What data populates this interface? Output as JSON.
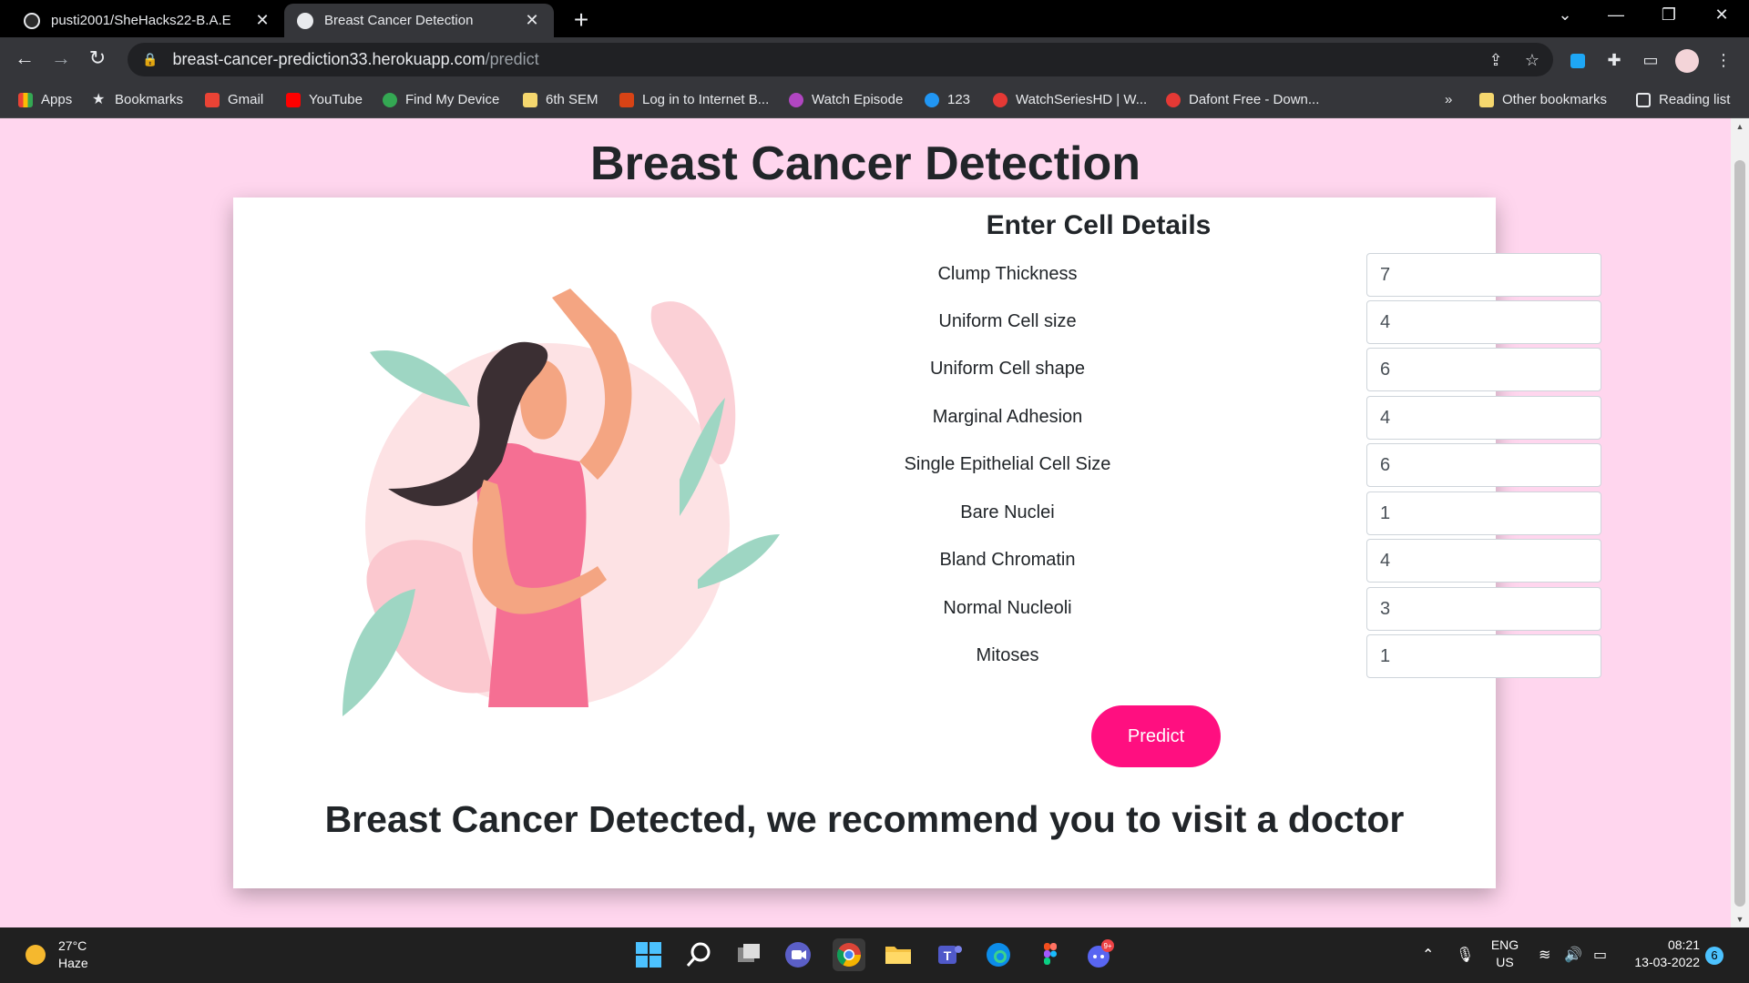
{
  "browser": {
    "tabs": [
      {
        "title": "pusti2001/SheHacks22-B.A.E",
        "active": false
      },
      {
        "title": "Breast Cancer Detection",
        "active": true
      }
    ],
    "url": {
      "host": "breast-cancer-prediction33.herokuapp.com",
      "path": "/predict"
    },
    "bookmarks": [
      "Apps",
      "Bookmarks",
      "Gmail",
      "YouTube",
      "Find My Device",
      "6th SEM",
      "Log in to Internet B...",
      "Watch Episode",
      "123",
      "WatchSeriesHD | W...",
      "Dafont Free - Down..."
    ],
    "other_bookmarks": "Other bookmarks",
    "reading_list": "Reading list",
    "overflow": "»"
  },
  "page": {
    "title": "Breast Cancer Detection",
    "form_title": "Enter Cell Details",
    "fields": [
      {
        "label": "Clump Thickness",
        "value": "7"
      },
      {
        "label": "Uniform Cell size",
        "value": "4"
      },
      {
        "label": "Uniform Cell shape",
        "value": "6"
      },
      {
        "label": "Marginal Adhesion",
        "value": "4"
      },
      {
        "label": "Single Epithelial Cell Size",
        "value": "6"
      },
      {
        "label": "Bare Nuclei",
        "value": "1"
      },
      {
        "label": "Bland Chromatin",
        "value": "4"
      },
      {
        "label": "Normal Nucleoli",
        "value": "3"
      },
      {
        "label": "Mitoses",
        "value": "1"
      }
    ],
    "predict_label": "Predict",
    "result": "Breast Cancer Detected, we recommend you to visit a doctor"
  },
  "taskbar": {
    "weather_temp": "27°C",
    "weather_desc": "Haze",
    "lang_line1": "ENG",
    "lang_line2": "US",
    "time": "08:21",
    "date": "13-03-2022",
    "notifications": "6",
    "discord_badge": "9+"
  },
  "colors": {
    "page_bg": "#ffd6ee",
    "accent": "#ff0f80"
  }
}
